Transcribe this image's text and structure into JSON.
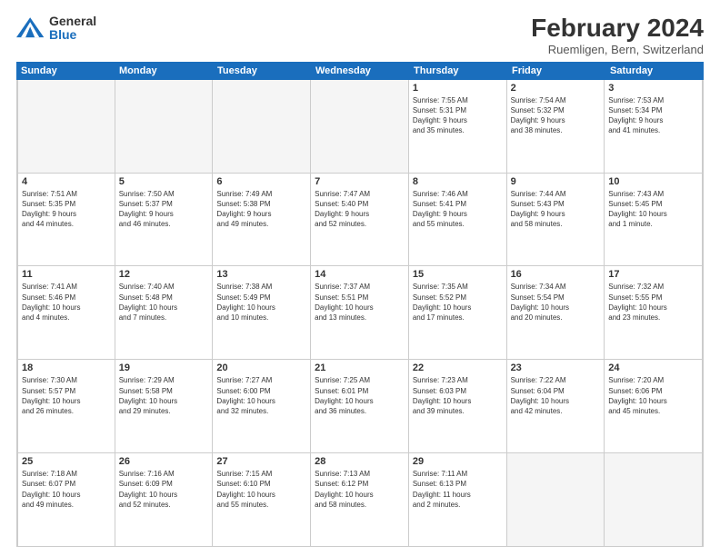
{
  "logo": {
    "general": "General",
    "blue": "Blue"
  },
  "title": "February 2024",
  "subtitle": "Ruemligen, Bern, Switzerland",
  "days_of_week": [
    "Sunday",
    "Monday",
    "Tuesday",
    "Wednesday",
    "Thursday",
    "Friday",
    "Saturday"
  ],
  "weeks": [
    [
      {
        "day": "",
        "info": "",
        "empty": true
      },
      {
        "day": "",
        "info": "",
        "empty": true
      },
      {
        "day": "",
        "info": "",
        "empty": true
      },
      {
        "day": "",
        "info": "",
        "empty": true
      },
      {
        "day": "1",
        "info": "Sunrise: 7:55 AM\nSunset: 5:31 PM\nDaylight: 9 hours\nand 35 minutes."
      },
      {
        "day": "2",
        "info": "Sunrise: 7:54 AM\nSunset: 5:32 PM\nDaylight: 9 hours\nand 38 minutes."
      },
      {
        "day": "3",
        "info": "Sunrise: 7:53 AM\nSunset: 5:34 PM\nDaylight: 9 hours\nand 41 minutes."
      }
    ],
    [
      {
        "day": "4",
        "info": "Sunrise: 7:51 AM\nSunset: 5:35 PM\nDaylight: 9 hours\nand 44 minutes."
      },
      {
        "day": "5",
        "info": "Sunrise: 7:50 AM\nSunset: 5:37 PM\nDaylight: 9 hours\nand 46 minutes."
      },
      {
        "day": "6",
        "info": "Sunrise: 7:49 AM\nSunset: 5:38 PM\nDaylight: 9 hours\nand 49 minutes."
      },
      {
        "day": "7",
        "info": "Sunrise: 7:47 AM\nSunset: 5:40 PM\nDaylight: 9 hours\nand 52 minutes."
      },
      {
        "day": "8",
        "info": "Sunrise: 7:46 AM\nSunset: 5:41 PM\nDaylight: 9 hours\nand 55 minutes."
      },
      {
        "day": "9",
        "info": "Sunrise: 7:44 AM\nSunset: 5:43 PM\nDaylight: 9 hours\nand 58 minutes."
      },
      {
        "day": "10",
        "info": "Sunrise: 7:43 AM\nSunset: 5:45 PM\nDaylight: 10 hours\nand 1 minute."
      }
    ],
    [
      {
        "day": "11",
        "info": "Sunrise: 7:41 AM\nSunset: 5:46 PM\nDaylight: 10 hours\nand 4 minutes."
      },
      {
        "day": "12",
        "info": "Sunrise: 7:40 AM\nSunset: 5:48 PM\nDaylight: 10 hours\nand 7 minutes."
      },
      {
        "day": "13",
        "info": "Sunrise: 7:38 AM\nSunset: 5:49 PM\nDaylight: 10 hours\nand 10 minutes."
      },
      {
        "day": "14",
        "info": "Sunrise: 7:37 AM\nSunset: 5:51 PM\nDaylight: 10 hours\nand 13 minutes."
      },
      {
        "day": "15",
        "info": "Sunrise: 7:35 AM\nSunset: 5:52 PM\nDaylight: 10 hours\nand 17 minutes."
      },
      {
        "day": "16",
        "info": "Sunrise: 7:34 AM\nSunset: 5:54 PM\nDaylight: 10 hours\nand 20 minutes."
      },
      {
        "day": "17",
        "info": "Sunrise: 7:32 AM\nSunset: 5:55 PM\nDaylight: 10 hours\nand 23 minutes."
      }
    ],
    [
      {
        "day": "18",
        "info": "Sunrise: 7:30 AM\nSunset: 5:57 PM\nDaylight: 10 hours\nand 26 minutes."
      },
      {
        "day": "19",
        "info": "Sunrise: 7:29 AM\nSunset: 5:58 PM\nDaylight: 10 hours\nand 29 minutes."
      },
      {
        "day": "20",
        "info": "Sunrise: 7:27 AM\nSunset: 6:00 PM\nDaylight: 10 hours\nand 32 minutes."
      },
      {
        "day": "21",
        "info": "Sunrise: 7:25 AM\nSunset: 6:01 PM\nDaylight: 10 hours\nand 36 minutes."
      },
      {
        "day": "22",
        "info": "Sunrise: 7:23 AM\nSunset: 6:03 PM\nDaylight: 10 hours\nand 39 minutes."
      },
      {
        "day": "23",
        "info": "Sunrise: 7:22 AM\nSunset: 6:04 PM\nDaylight: 10 hours\nand 42 minutes."
      },
      {
        "day": "24",
        "info": "Sunrise: 7:20 AM\nSunset: 6:06 PM\nDaylight: 10 hours\nand 45 minutes."
      }
    ],
    [
      {
        "day": "25",
        "info": "Sunrise: 7:18 AM\nSunset: 6:07 PM\nDaylight: 10 hours\nand 49 minutes."
      },
      {
        "day": "26",
        "info": "Sunrise: 7:16 AM\nSunset: 6:09 PM\nDaylight: 10 hours\nand 52 minutes."
      },
      {
        "day": "27",
        "info": "Sunrise: 7:15 AM\nSunset: 6:10 PM\nDaylight: 10 hours\nand 55 minutes."
      },
      {
        "day": "28",
        "info": "Sunrise: 7:13 AM\nSunset: 6:12 PM\nDaylight: 10 hours\nand 58 minutes."
      },
      {
        "day": "29",
        "info": "Sunrise: 7:11 AM\nSunset: 6:13 PM\nDaylight: 11 hours\nand 2 minutes."
      },
      {
        "day": "",
        "info": "",
        "empty": true
      },
      {
        "day": "",
        "info": "",
        "empty": true
      }
    ]
  ]
}
